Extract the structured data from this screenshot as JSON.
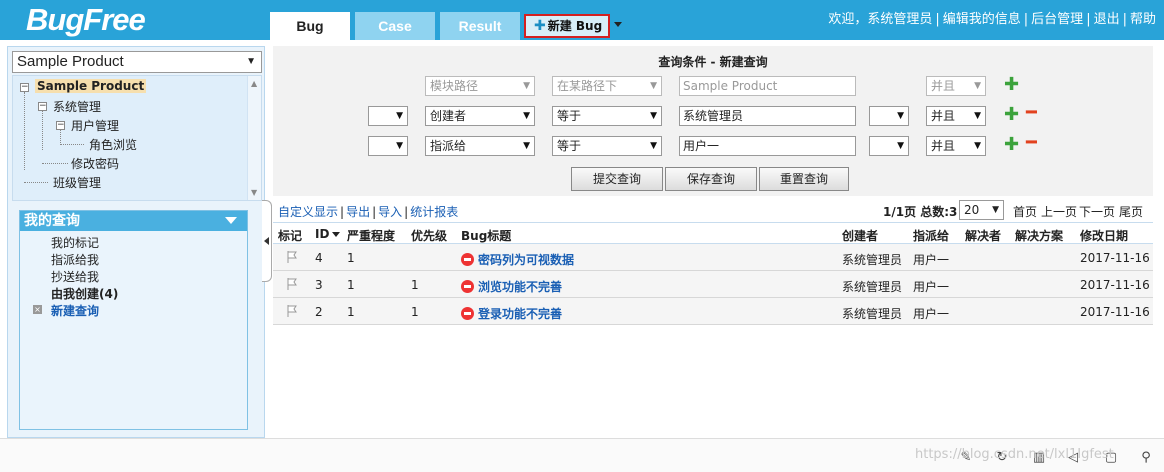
{
  "header": {
    "logo": "BugFree",
    "tabs": {
      "bug": "Bug",
      "case": "Case",
      "result": "Result"
    },
    "new_bug": "新建 Bug",
    "links": [
      "欢迎，系统管理员",
      "编辑我的信息",
      "后台管理",
      "退出",
      "帮助"
    ]
  },
  "left": {
    "product_select": "Sample Product",
    "tree": {
      "root": "Sample Product",
      "system": "系统管理",
      "user": "用户管理",
      "role": "角色浏览",
      "password": "修改密码",
      "class": "班级管理"
    },
    "my_query": {
      "title": "我的查询",
      "items": [
        "我的标记",
        "指派给我",
        "抄送给我",
        "由我创建(4)",
        "新建查询"
      ]
    }
  },
  "query": {
    "title": "查询条件 - 新建查询",
    "row1": {
      "field": "模块路径",
      "op": "在某路径下",
      "value": "Sample Product",
      "logic": "并且"
    },
    "row2": {
      "field": "创建者",
      "op": "等于",
      "value": "系统管理员",
      "logic": "并且"
    },
    "row3": {
      "field": "指派给",
      "op": "等于",
      "value": "用户一",
      "logic": "并且"
    },
    "buttons": {
      "submit": "提交查询",
      "save": "保存查询",
      "reset": "重置查询"
    }
  },
  "toolbar": {
    "custom": "自定义显示",
    "export": "导出",
    "import": "导入",
    "report": "统计报表",
    "page_info": "1/1页 总数:3",
    "page_size": "20",
    "first": "首页",
    "prev": "上一页",
    "next": "下一页",
    "last": "尾页"
  },
  "table": {
    "headers": [
      "标记",
      "ID",
      "严重程度",
      "优先级",
      "Bug标题",
      "创建者",
      "指派给",
      "解决者",
      "解决方案",
      "修改日期"
    ],
    "rows": [
      {
        "id": "4",
        "severity": "1",
        "priority": "",
        "title": "密码列为可视数据",
        "creator": "系统管理员",
        "assignee": "用户一",
        "resolver": "",
        "resolution": "",
        "date": "2017-11-16"
      },
      {
        "id": "3",
        "severity": "1",
        "priority": "1",
        "title": "浏览功能不完善",
        "creator": "系统管理员",
        "assignee": "用户一",
        "resolver": "",
        "resolution": "",
        "date": "2017-11-16"
      },
      {
        "id": "2",
        "severity": "1",
        "priority": "1",
        "title": "登录功能不完善",
        "creator": "系统管理员",
        "assignee": "用户一",
        "resolver": "",
        "resolution": "",
        "date": "2017-11-16"
      }
    ]
  },
  "watermark": "https://blog.csdn.net/lxl1Igfest",
  "statusbar_icons": [
    "pin-icon",
    "refresh-icon",
    "trash-icon",
    "speaker-icon",
    "window-icon",
    "search-icon"
  ]
}
